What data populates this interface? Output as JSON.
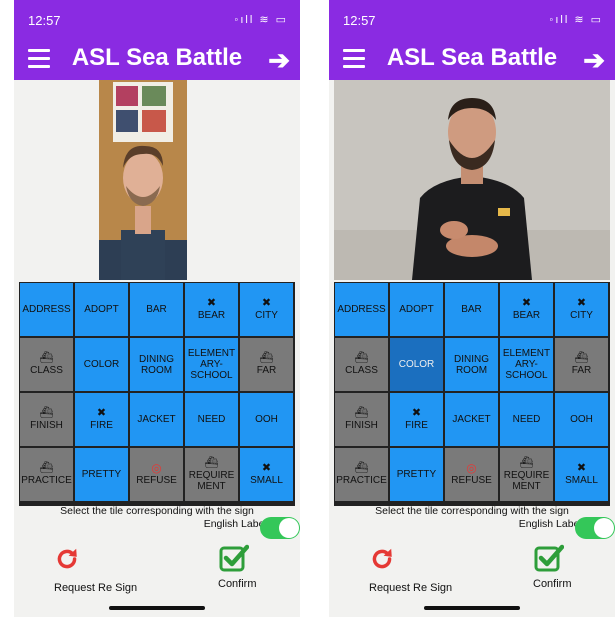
{
  "status_bar": {
    "time": "12:57",
    "icons": "◦ıll ≋ ▭"
  },
  "app": {
    "title": "ASL Sea Battle"
  },
  "left_tiles": [
    {
      "label": "ADDRESS",
      "icon": "",
      "state": "blue"
    },
    {
      "label": "ADOPT",
      "icon": "",
      "state": "blue"
    },
    {
      "label": "BAR",
      "icon": "",
      "state": "blue"
    },
    {
      "label": "BEAR",
      "icon": "✖",
      "state": "blue"
    },
    {
      "label": "CITY",
      "icon": "✖",
      "state": "blue"
    },
    {
      "label": "CLASS",
      "icon": "⛴",
      "state": "gray"
    },
    {
      "label": "COLOR",
      "icon": "",
      "state": "blue"
    },
    {
      "label": "DINING ROOM",
      "icon": "",
      "state": "blue"
    },
    {
      "label": "ELEMENT ARY- SCHOOL",
      "icon": "",
      "state": "blue"
    },
    {
      "label": "FAR",
      "icon": "⛴",
      "state": "gray"
    },
    {
      "label": "FINISH",
      "icon": "⛴",
      "state": "gray"
    },
    {
      "label": "FIRE",
      "icon": "✖",
      "state": "blue"
    },
    {
      "label": "JACKET",
      "icon": "",
      "state": "blue"
    },
    {
      "label": "NEED",
      "icon": "",
      "state": "blue"
    },
    {
      "label": "OOH",
      "icon": "",
      "state": "blue"
    },
    {
      "label": "PRACTICE",
      "icon": "⛴",
      "state": "gray"
    },
    {
      "label": "PRETTY",
      "icon": "",
      "state": "blue"
    },
    {
      "label": "REFUSE",
      "icon": "◎",
      "state": "gray"
    },
    {
      "label": "REQUIRE MENT",
      "icon": "⛴",
      "state": "gray"
    },
    {
      "label": "SMALL",
      "icon": "✖",
      "state": "blue"
    }
  ],
  "right_tiles": [
    {
      "label": "ADDRESS",
      "icon": "",
      "state": "blue"
    },
    {
      "label": "ADOPT",
      "icon": "",
      "state": "blue"
    },
    {
      "label": "BAR",
      "icon": "",
      "state": "blue"
    },
    {
      "label": "BEAR",
      "icon": "✖",
      "state": "blue"
    },
    {
      "label": "CITY",
      "icon": "✖",
      "state": "blue"
    },
    {
      "label": "CLASS",
      "icon": "⛴",
      "state": "gray"
    },
    {
      "label": "COLOR",
      "icon": "",
      "state": "selected"
    },
    {
      "label": "DINING ROOM",
      "icon": "",
      "state": "blue"
    },
    {
      "label": "ELEMENT ARY- SCHOOL",
      "icon": "",
      "state": "blue"
    },
    {
      "label": "FAR",
      "icon": "⛴",
      "state": "gray"
    },
    {
      "label": "FINISH",
      "icon": "⛴",
      "state": "gray"
    },
    {
      "label": "FIRE",
      "icon": "✖",
      "state": "blue"
    },
    {
      "label": "JACKET",
      "icon": "",
      "state": "blue"
    },
    {
      "label": "NEED",
      "icon": "",
      "state": "blue"
    },
    {
      "label": "OOH",
      "icon": "",
      "state": "blue"
    },
    {
      "label": "PRACTICE",
      "icon": "⛴",
      "state": "gray"
    },
    {
      "label": "PRETTY",
      "icon": "",
      "state": "blue"
    },
    {
      "label": "REFUSE",
      "icon": "◎",
      "state": "gray"
    },
    {
      "label": "REQUIRE MENT",
      "icon": "⛴",
      "state": "gray"
    },
    {
      "label": "SMALL",
      "icon": "✖",
      "state": "blue"
    }
  ],
  "footer": {
    "instruction": "Select the tile corresponding with the sign",
    "english_labels": "English Labels",
    "english_labels_on": true,
    "request_resign": "Request Re Sign",
    "confirm": "Confirm"
  },
  "colors": {
    "header": "#8a2be2",
    "tile_blue": "#2196f3",
    "tile_gray": "#7a7a7a",
    "tile_selected": "#1b6fbf",
    "toggle": "#34c759",
    "resign": "#e53935",
    "confirm": "#2e9e3a"
  }
}
